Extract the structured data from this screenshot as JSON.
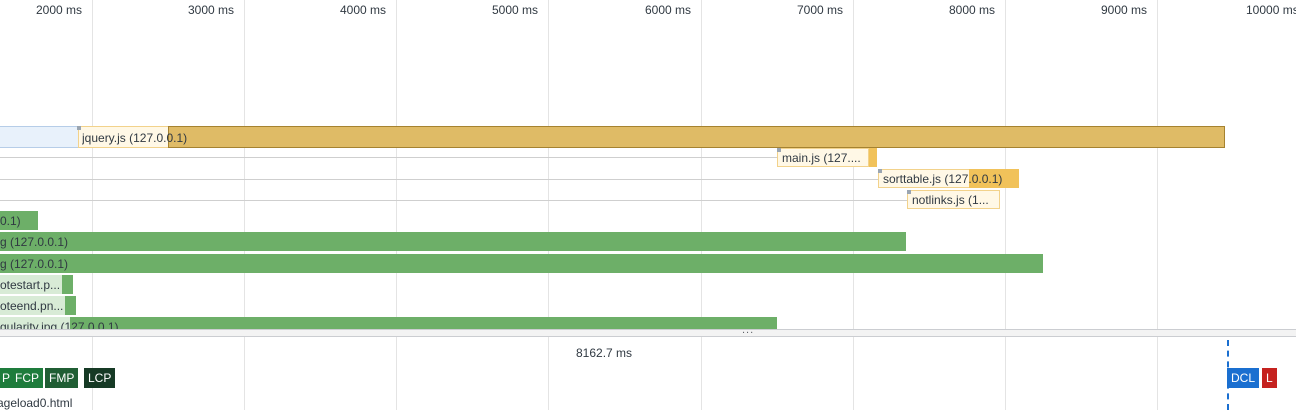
{
  "ruler": {
    "ticks": [
      "2000 ms",
      "3000 ms",
      "4000 ms",
      "5000 ms",
      "6000 ms",
      "7000 ms",
      "8000 ms",
      "9000 ms",
      "10000 ms"
    ]
  },
  "requests": {
    "jquery": {
      "label": "jquery.js (127.0.0.1)"
    },
    "main": {
      "label": "main.js (127...."
    },
    "sorttable": {
      "label": "sorttable.js (127.0.0.1)"
    },
    "notlinks": {
      "label": "notlinks.js (1..."
    },
    "img1": {
      "label": "0.1)"
    },
    "img2": {
      "label": "g (127.0.0.1)"
    },
    "img3": {
      "label": "g (127.0.0.1)"
    },
    "img4": {
      "label": "otestart.p..."
    },
    "img5": {
      "label": "oteend.pn..."
    },
    "img6": {
      "label": "gularity.jpg (127.0.0.1)"
    }
  },
  "summary": {
    "duration": "8162.7 ms",
    "grip": "..."
  },
  "markers": {
    "p": "P",
    "fcp": "FCP",
    "fmp": "FMP",
    "lcp": "LCP",
    "dcl": "DCL",
    "l": "L"
  },
  "colors": {
    "script_receive": "#dfbb66",
    "script_wait": "#fff8e6",
    "image_receive": "#6daf68",
    "dcl": "#1a6fd0",
    "load": "#c5221f"
  },
  "file": {
    "name": "ageload0.html"
  }
}
